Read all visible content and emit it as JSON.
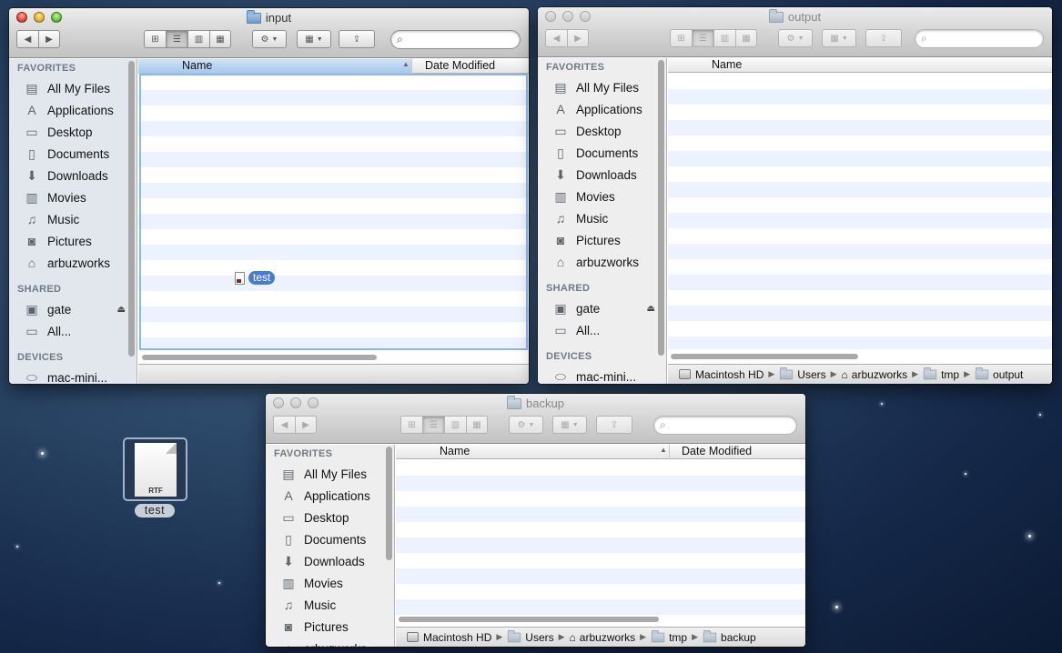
{
  "desktop": {
    "file_label": "test",
    "file_type": "RTF",
    "background_color": "#1d3557"
  },
  "sidebar": {
    "favorites_heading": "FAVORITES",
    "shared_heading": "SHARED",
    "devices_heading": "DEVICES",
    "favorites": [
      {
        "label": "All My Files",
        "icon": "all-files-icon"
      },
      {
        "label": "Applications",
        "icon": "applications-icon"
      },
      {
        "label": "Desktop",
        "icon": "desktop-icon"
      },
      {
        "label": "Documents",
        "icon": "documents-icon"
      },
      {
        "label": "Downloads",
        "icon": "downloads-icon"
      },
      {
        "label": "Movies",
        "icon": "movies-icon"
      },
      {
        "label": "Music",
        "icon": "music-icon"
      },
      {
        "label": "Pictures",
        "icon": "pictures-icon"
      },
      {
        "label": "arbuzworks",
        "icon": "home-icon"
      }
    ],
    "shared": [
      {
        "label": "gate",
        "icon": "server-icon"
      },
      {
        "label": "All...",
        "icon": "network-icon"
      }
    ],
    "devices": [
      {
        "label": "mac-mini...",
        "icon": "disk-icon"
      }
    ]
  },
  "columns": {
    "name": "Name",
    "date_modified": "Date Modified"
  },
  "windows": {
    "input": {
      "title": "input",
      "active": true,
      "dragged_item": "test"
    },
    "output": {
      "title": "output",
      "active": false,
      "path": [
        "Macintosh HD",
        "Users",
        "arbuzworks",
        "tmp",
        "output"
      ]
    },
    "backup": {
      "title": "backup",
      "active": false,
      "path": [
        "Macintosh HD",
        "Users",
        "arbuzworks",
        "tmp",
        "backup"
      ]
    }
  }
}
